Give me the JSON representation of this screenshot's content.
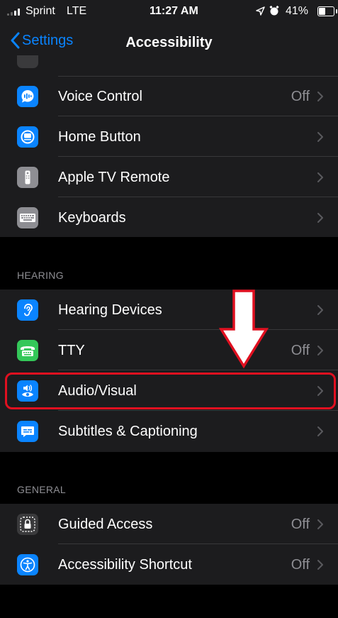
{
  "status_bar": {
    "carrier": "Sprint",
    "network": "LTE",
    "time": "11:27 AM",
    "battery": "41%"
  },
  "nav": {
    "back_label": "Settings",
    "title": "Accessibility"
  },
  "sections": [
    {
      "header": "",
      "rows": [
        {
          "label": "Voice Control",
          "value": "Off",
          "icon": "voice-control-icon",
          "color": "#0a84ff"
        },
        {
          "label": "Home Button",
          "value": "",
          "icon": "home-button-icon",
          "color": "#0a84ff"
        },
        {
          "label": "Apple TV Remote",
          "value": "",
          "icon": "tv-remote-icon",
          "color": "#8e8e93"
        },
        {
          "label": "Keyboards",
          "value": "",
          "icon": "keyboard-icon",
          "color": "#8e8e93"
        }
      ]
    },
    {
      "header": "HEARING",
      "rows": [
        {
          "label": "Hearing Devices",
          "value": "",
          "icon": "ear-icon",
          "color": "#0a84ff"
        },
        {
          "label": "TTY",
          "value": "Off",
          "icon": "tty-icon",
          "color": "#34c759"
        },
        {
          "label": "Audio/Visual",
          "value": "",
          "icon": "audio-visual-icon",
          "color": "#0a84ff"
        },
        {
          "label": "Subtitles & Captioning",
          "value": "",
          "icon": "captions-icon",
          "color": "#0a84ff"
        }
      ]
    },
    {
      "header": "GENERAL",
      "rows": [
        {
          "label": "Guided Access",
          "value": "Off",
          "icon": "lock-icon",
          "color": "#3a3a3c"
        },
        {
          "label": "Accessibility Shortcut",
          "value": "Off",
          "icon": "accessibility-icon",
          "color": "#0a84ff"
        }
      ]
    }
  ],
  "annotation": {
    "highlight_color": "#e01020"
  }
}
